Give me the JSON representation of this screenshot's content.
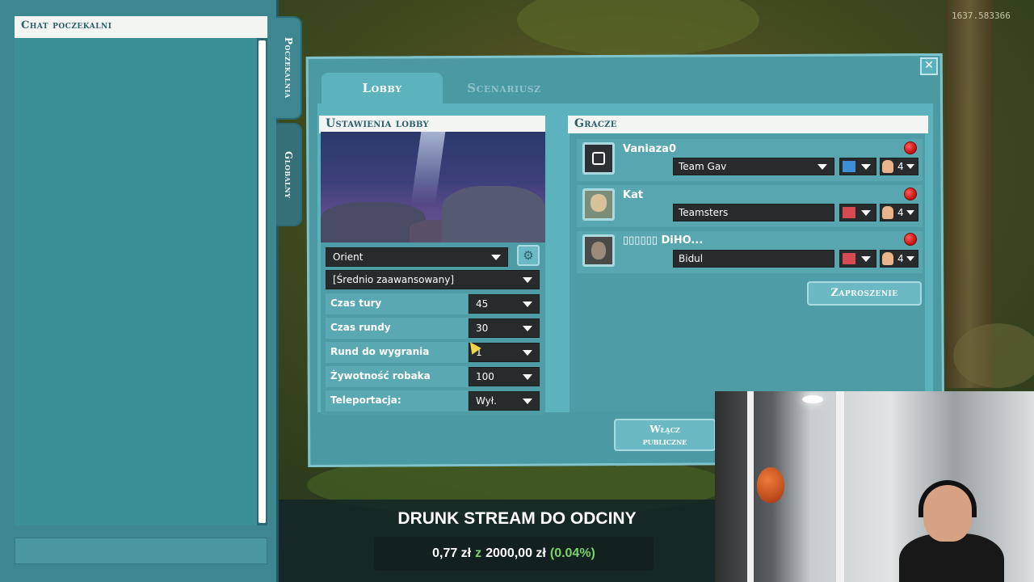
{
  "counter": "1637.583366",
  "chat": {
    "title": "Chat poczekalni"
  },
  "side_tabs": [
    "Poczekalnia",
    "Globalny"
  ],
  "window": {
    "close_label": "✕",
    "tabs": [
      {
        "label": "Lobby",
        "active": true
      },
      {
        "label": "Scenariusz",
        "active": false
      }
    ]
  },
  "settings": {
    "header": "Ustawienia lobby",
    "map_name": "Orient",
    "difficulty": "[Średnio zaawansowany]",
    "options": [
      {
        "label": "Czas tury",
        "value": "45"
      },
      {
        "label": "Czas rundy",
        "value": "30"
      },
      {
        "label": "Rund do wygrania",
        "value": "1"
      },
      {
        "label": "Żywotność robaka",
        "value": "100"
      },
      {
        "label": "Teleportacja:",
        "value": "Wył."
      }
    ]
  },
  "players": {
    "header": "Gracze",
    "list": [
      {
        "name": "Vaniaza0",
        "team": "Team Gav",
        "color": "#3f8fd8",
        "worms": "4"
      },
      {
        "name": "Kat",
        "team": "Teamsters",
        "color": "#d64b52",
        "worms": "4"
      },
      {
        "name": "▯▯▯▯▯▯ DiHO...",
        "team": "Bidul",
        "color": "#d64b52",
        "worms": "4"
      }
    ],
    "invite_label": "Zaproszenie"
  },
  "public_button": {
    "line1": "Włącz",
    "line2": "publiczne"
  },
  "stream": {
    "title": "DRUNK STREAM DO ODCINY",
    "amount": "0,77 zł",
    "z": "z",
    "goal": "2000,00 zł",
    "percent": "(0.04%)"
  },
  "colors": {
    "panel": "#4b99a2",
    "header": "#f3f5f3",
    "dropdown": "#272b2c",
    "ready": "#d11a1a",
    "goal_green": "#7bd16a"
  }
}
